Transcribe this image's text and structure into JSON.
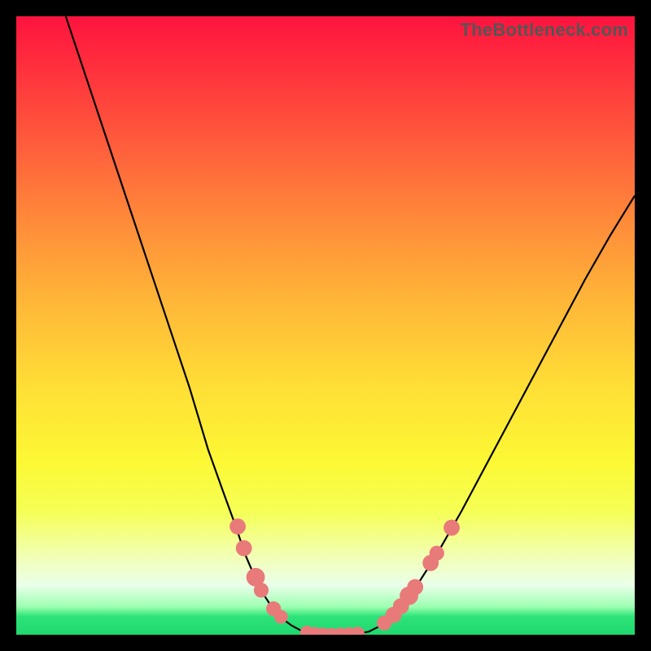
{
  "watermark": "TheBottleneck.com",
  "colors": {
    "frame_bg_top": "#ff133f",
    "frame_bg_bottom": "#1ed86e",
    "curve_stroke": "#000000",
    "dot_fill": "#e87a7a",
    "page_bg": "#000000"
  },
  "chart_data": {
    "type": "line",
    "title": "",
    "xlabel": "",
    "ylabel": "",
    "xlim": [
      0,
      100
    ],
    "ylim": [
      0,
      100
    ],
    "series": [
      {
        "name": "left-branch",
        "x": [
          8,
          12,
          16,
          20,
          24,
          28,
          31,
          33.5,
          35.5,
          37,
          38.5,
          40,
          41.5,
          43,
          44.5,
          46,
          47.5
        ],
        "y": [
          100,
          88,
          76,
          64,
          52,
          40,
          30,
          23,
          17.5,
          13,
          9.5,
          6.5,
          4.2,
          2.6,
          1.5,
          0.7,
          0.2
        ]
      },
      {
        "name": "valley-floor",
        "x": [
          47.5,
          49,
          50.5,
          52,
          53.5,
          55,
          56,
          57
        ],
        "y": [
          0.2,
          0.05,
          0.0,
          0.0,
          0.05,
          0.15,
          0.3,
          0.5
        ]
      },
      {
        "name": "right-branch",
        "x": [
          57,
          59,
          61,
          63,
          65,
          68,
          72,
          76,
          80,
          84,
          88,
          92,
          96,
          100
        ],
        "y": [
          0.5,
          1.5,
          3.2,
          5.5,
          8.3,
          13,
          20,
          27.5,
          35,
          42.5,
          50,
          57.5,
          64.5,
          71
        ]
      }
    ],
    "markers": [
      {
        "name": "left-cluster",
        "x": 35.8,
        "y": 17.5,
        "r": 1.3
      },
      {
        "name": "left-cluster",
        "x": 36.8,
        "y": 14.0,
        "r": 1.3
      },
      {
        "name": "left-cluster",
        "x": 38.7,
        "y": 9.3,
        "r": 1.5
      },
      {
        "name": "left-cluster",
        "x": 39.6,
        "y": 7.2,
        "r": 1.2
      },
      {
        "name": "left-cluster",
        "x": 41.6,
        "y": 4.2,
        "r": 1.2
      },
      {
        "name": "left-cluster",
        "x": 42.8,
        "y": 2.9,
        "r": 1.1
      },
      {
        "name": "floor-cluster",
        "x": 47.0,
        "y": 0.35,
        "r": 1.1
      },
      {
        "name": "floor-cluster",
        "x": 48.3,
        "y": 0.15,
        "r": 1.1
      },
      {
        "name": "floor-cluster",
        "x": 49.6,
        "y": 0.05,
        "r": 1.1
      },
      {
        "name": "floor-cluster",
        "x": 51.0,
        "y": 0.0,
        "r": 1.1
      },
      {
        "name": "floor-cluster",
        "x": 52.4,
        "y": 0.05,
        "r": 1.1
      },
      {
        "name": "floor-cluster",
        "x": 53.8,
        "y": 0.1,
        "r": 1.1
      },
      {
        "name": "floor-cluster",
        "x": 55.2,
        "y": 0.2,
        "r": 1.1
      },
      {
        "name": "right-cluster",
        "x": 59.5,
        "y": 1.9,
        "r": 1.2
      },
      {
        "name": "right-cluster",
        "x": 61.0,
        "y": 3.2,
        "r": 1.3
      },
      {
        "name": "right-cluster",
        "x": 62.2,
        "y": 4.6,
        "r": 1.3
      },
      {
        "name": "right-cluster",
        "x": 63.5,
        "y": 6.3,
        "r": 1.5
      },
      {
        "name": "right-cluster",
        "x": 64.5,
        "y": 7.7,
        "r": 1.3
      },
      {
        "name": "right-cluster",
        "x": 67.0,
        "y": 11.6,
        "r": 1.3
      },
      {
        "name": "right-cluster",
        "x": 68.0,
        "y": 13.2,
        "r": 1.2
      },
      {
        "name": "right-cluster",
        "x": 70.4,
        "y": 17.3,
        "r": 1.3
      }
    ]
  }
}
